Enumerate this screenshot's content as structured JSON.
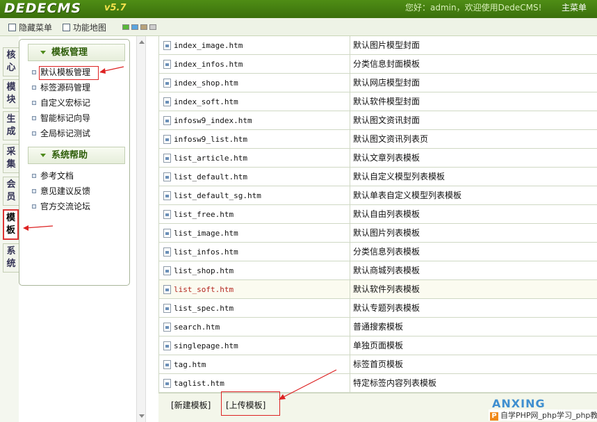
{
  "header": {
    "logo": "DEDECMS",
    "version": "v5.7",
    "welcome": "您好：admin，欢迎使用DedeCMS!",
    "main_menu": "主菜单"
  },
  "toolbar": {
    "hide_menu": "隐藏菜单",
    "function_map": "功能地图",
    "swatches": [
      "#59b83a",
      "#5aa6e0",
      "#b7a27a",
      "#cccccc"
    ]
  },
  "vtabs": [
    {
      "label": "核心",
      "active": false
    },
    {
      "label": "模块",
      "active": false
    },
    {
      "label": "生成",
      "active": false
    },
    {
      "label": "采集",
      "active": false
    },
    {
      "label": "会员",
      "active": false
    },
    {
      "label": "模板",
      "active": true
    },
    {
      "label": "系统",
      "active": false
    }
  ],
  "menu": {
    "section1_title": "模板管理",
    "section1_items": [
      "默认模板管理",
      "标签源码管理",
      "自定义宏标记",
      "智能标记向导",
      "全局标记测试"
    ],
    "section2_title": "系统帮助",
    "section2_items": [
      "参考文档",
      "意见建议反馈",
      "官方交流论坛"
    ]
  },
  "files": [
    {
      "name": "index_image.htm",
      "desc": "默认图片模型封面"
    },
    {
      "name": "index_infos.htm",
      "desc": "分类信息封面模板"
    },
    {
      "name": "index_shop.htm",
      "desc": "默认网店模型封面"
    },
    {
      "name": "index_soft.htm",
      "desc": "默认软件模型封面"
    },
    {
      "name": "infosw9_index.htm",
      "desc": "默认图文资讯封面"
    },
    {
      "name": "infosw9_list.htm",
      "desc": "默认图文资讯列表页"
    },
    {
      "name": "list_article.htm",
      "desc": "默认文章列表模板"
    },
    {
      "name": "list_default.htm",
      "desc": "默认自定义模型列表模板"
    },
    {
      "name": "list_default_sg.htm",
      "desc": "默认单表自定义模型列表模板"
    },
    {
      "name": "list_free.htm",
      "desc": "默认自由列表模板"
    },
    {
      "name": "list_image.htm",
      "desc": "默认图片列表模板"
    },
    {
      "name": "list_infos.htm",
      "desc": "分类信息列表模板"
    },
    {
      "name": "list_shop.htm",
      "desc": "默认商城列表模板"
    },
    {
      "name": "list_soft.htm",
      "desc": "默认软件列表模板"
    },
    {
      "name": "list_spec.htm",
      "desc": "默认专题列表模板"
    },
    {
      "name": "search.htm",
      "desc": "普通搜索模板"
    },
    {
      "name": "singlepage.htm",
      "desc": "单独页面模板"
    },
    {
      "name": "tag.htm",
      "desc": "标签首页模板"
    },
    {
      "name": "taglist.htm",
      "desc": "特定标签内容列表模板"
    }
  ],
  "actions": {
    "new_template": "[新建模板]",
    "upload_template": "[上传模板]"
  },
  "watermark": {
    "logo": "ANXING",
    "text": "自学PHP网_php学习_php教"
  }
}
